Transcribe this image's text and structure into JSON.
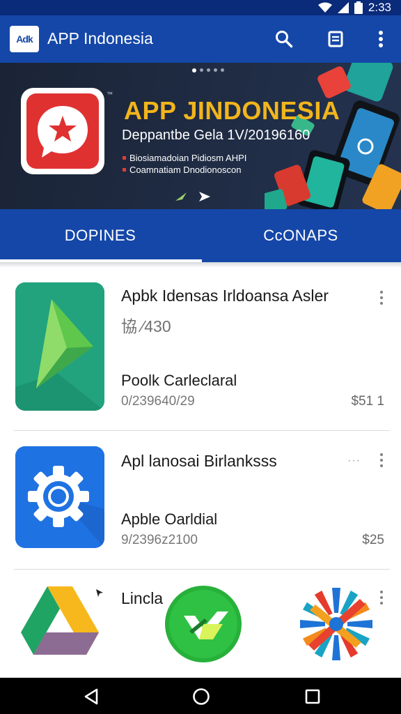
{
  "status_bar": {
    "time": "2:33"
  },
  "app_bar": {
    "logo_text": "Adk",
    "title": "APP Indonesia",
    "search_icon": "search-icon",
    "list_icon": "document-icon",
    "more_icon": "more-vert-icon"
  },
  "banner": {
    "title": "APP JINDONESIA",
    "subtitle": "Deppantbe Gela 1V/20196160",
    "tm": "™",
    "bullets": [
      "Biosiamadoian Pidiosm AHPI",
      "Coamnatiam Dnodionoscon"
    ],
    "page_count": 5,
    "active_page": 1,
    "icon": "star-chat-icon"
  },
  "tabs": [
    {
      "label": "DOPINES",
      "selected": true
    },
    {
      "label": "CcONAPS",
      "selected": false
    }
  ],
  "apps": [
    {
      "name": "Apbk Idensas Irldoansa Asler",
      "rating": "協 ⁄430",
      "developer": "Poolk Carleclaral",
      "date": "0/239640/29",
      "price": "$51 1",
      "icon": "arrow-app-icon",
      "colors": {
        "bg": "#1f9e78",
        "fg": "#5fc74c"
      }
    },
    {
      "name": "Apl lanosai Birlanksss",
      "developer": "Apble Oarldial",
      "date": "9/2396z2100",
      "price": "$25",
      "icon": "gear-app-icon",
      "ellipsis": "···",
      "colors": {
        "bg": "#1e6fe0",
        "fg": "#ffffff"
      }
    },
    {
      "name": "Lincla",
      "icons": [
        "drive-triangle-icon",
        "green-circle-app-icon",
        "colorful-star-app-icon"
      ],
      "colors": {
        "accent": "#27b13a"
      }
    }
  ],
  "colors": {
    "primary": "#1547a8",
    "status": "#0a2a7a",
    "banner_title": "#f2b51c",
    "red": "#e03131"
  }
}
